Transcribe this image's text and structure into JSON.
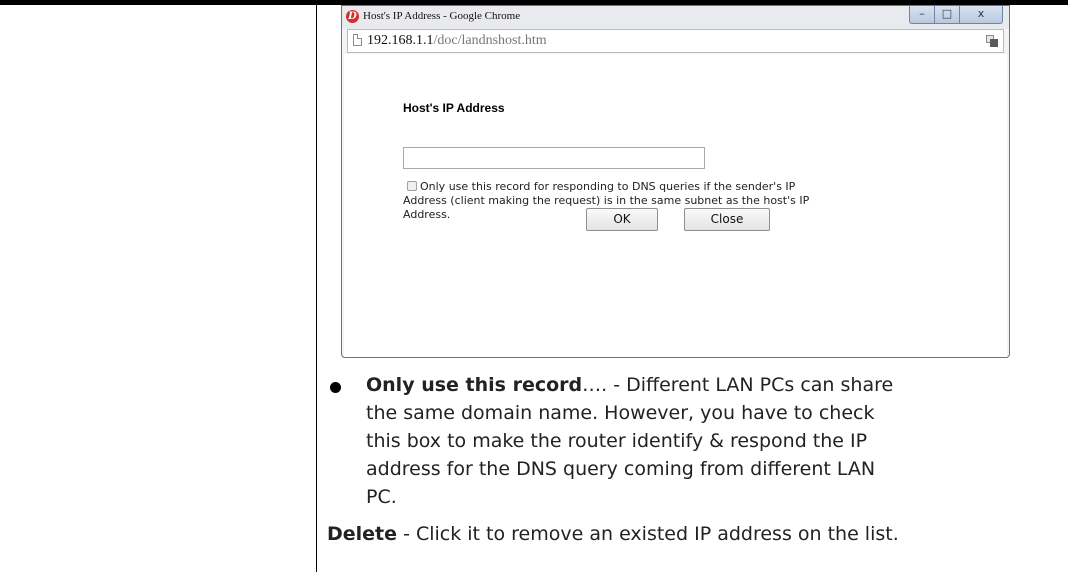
{
  "popup": {
    "window_title": "Host's IP Address - Google Chrome",
    "window_buttons": {
      "minimize": "–",
      "maximize": "□",
      "close": "x"
    },
    "url_host": "192.168.1.1",
    "url_path": "/doc/landnshost.htm",
    "field_label": "Host's IP Address",
    "field_value": "",
    "option_lines": [
      "Only use this record for responding to DNS queries if the sender's IP",
      "Address (client making the request) is in the same subnet as the host's IP",
      "Address."
    ],
    "option_checked": false,
    "ok_label": "OK",
    "close_label": "Close"
  },
  "doc": {
    "bullet_term": "Only use this record",
    "bullet_ellipsis": "….",
    "bullet_lines": [
      " - Different LAN PCs can share",
      "the same domain name. However, you have to check",
      "this box to make the router identify & respond the IP",
      "address for the DNS query coming from different LAN",
      "PC."
    ],
    "delete_term": "Delete",
    "delete_text": " - Click it to remove an existed IP address on the list."
  },
  "colors": {
    "titlebar": "#e9eaee",
    "app_icon": "#d62d2d",
    "window_border": "#6b7280"
  }
}
